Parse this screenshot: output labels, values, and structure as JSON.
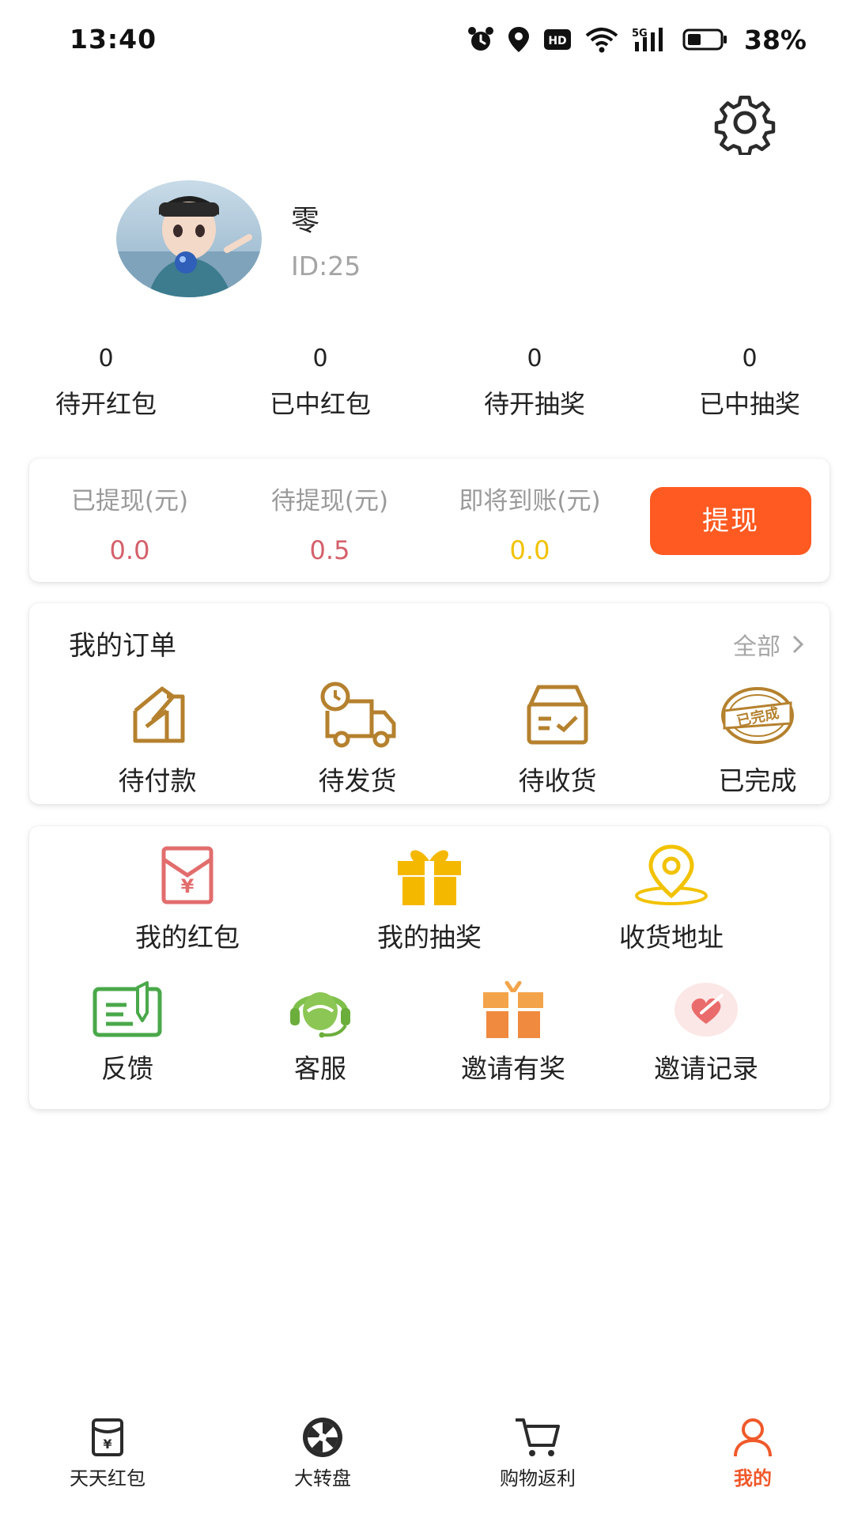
{
  "status_bar": {
    "time": "13:40",
    "network": "5G",
    "battery": "38%",
    "icons": [
      "alarm-icon",
      "location-icon",
      "hd-icon",
      "wifi-icon",
      "signal-icon",
      "battery-icon"
    ]
  },
  "profile": {
    "nickname": "零",
    "id_text": "ID:25"
  },
  "stats": [
    {
      "count": "0",
      "label": "待开红包"
    },
    {
      "count": "0",
      "label": "已中红包"
    },
    {
      "count": "0",
      "label": "待开抽奖"
    },
    {
      "count": "0",
      "label": "已中抽奖"
    }
  ],
  "wallet": {
    "withdrawn_label": "已提现(元)",
    "withdrawn_value": "0.0",
    "pending_label": "待提现(元)",
    "pending_value": "0.5",
    "arriving_label": "即将到账(元)",
    "arriving_value": "0.0",
    "withdraw_button": "提现"
  },
  "orders": {
    "title": "我的订单",
    "all_label": "全部",
    "items": [
      {
        "label": "待付款",
        "icon": "wallet-icon"
      },
      {
        "label": "待发货",
        "icon": "delivery-truck-icon"
      },
      {
        "label": "待收货",
        "icon": "inbox-icon"
      },
      {
        "label": "已完成",
        "icon": "completed-stamp-icon"
      }
    ],
    "stamp_text": "已完成"
  },
  "tools": {
    "row1": [
      {
        "label": "我的红包",
        "icon": "red-envelope-icon"
      },
      {
        "label": "我的抽奖",
        "icon": "gift-icon"
      },
      {
        "label": "收货地址",
        "icon": "location-pin-icon"
      }
    ],
    "row2": [
      {
        "label": "反馈",
        "icon": "feedback-icon"
      },
      {
        "label": "客服",
        "icon": "customer-service-icon"
      },
      {
        "label": "邀请有奖",
        "icon": "invite-gift-icon"
      },
      {
        "label": "邀请记录",
        "icon": "invite-record-icon"
      }
    ]
  },
  "bottom_nav": [
    {
      "label": "天天红包",
      "icon": "red-envelope-tab-icon"
    },
    {
      "label": "大转盘",
      "icon": "wheel-icon"
    },
    {
      "label": "购物返利",
      "icon": "cart-icon"
    },
    {
      "label": "我的",
      "icon": "user-icon"
    }
  ],
  "colors": {
    "accent": "#ff5a22",
    "withdrawn_value": "#d4606a",
    "pending_value": "#d4606a",
    "arriving_value": "#f2c200",
    "order_icon": "#b5812e",
    "active_tab": "#f0592a"
  }
}
